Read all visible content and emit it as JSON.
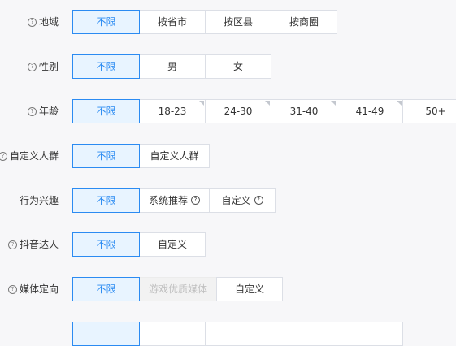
{
  "rows": {
    "region": {
      "label": "地域",
      "options": [
        "不限",
        "按省市",
        "按区县",
        "按商圈"
      ]
    },
    "gender": {
      "label": "性别",
      "options": [
        "不限",
        "男",
        "女"
      ]
    },
    "age": {
      "label": "年龄",
      "options": [
        "不限",
        "18-23",
        "24-30",
        "31-40",
        "41-49",
        "50+"
      ]
    },
    "custom_audience": {
      "label": "自定义人群",
      "options": [
        "不限",
        "自定义人群"
      ]
    },
    "interest": {
      "label": "行为兴趣",
      "options": [
        "不限",
        "系统推荐",
        "自定义"
      ]
    },
    "douyin_kol": {
      "label": "抖音达人",
      "options": [
        "不限",
        "自定义"
      ]
    },
    "media": {
      "label": "媒体定向",
      "options": [
        "不限",
        "游戏优质媒体",
        "自定义"
      ]
    }
  },
  "icons": {
    "help": "question-circle-icon",
    "corner": "corner-triangle-icon"
  },
  "colors": {
    "accent": "#2b8bf2",
    "selected_bg": "#e8f4ff",
    "border": "#dcdfe6",
    "disabled_text": "#c0c0c0"
  }
}
